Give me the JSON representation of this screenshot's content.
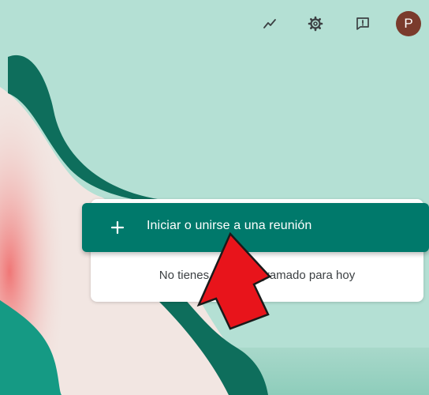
{
  "header": {
    "avatar_initial": "P",
    "icons": [
      "activity-icon",
      "gear-icon",
      "feedback-icon"
    ]
  },
  "main": {
    "action_button_label": "Iniciar o unirse a una reunión",
    "empty_message": "No tienes nada programado para hoy"
  },
  "colors": {
    "background": "#b0ded2",
    "accent": "#00796b",
    "avatar": "#7a3b2c",
    "arrow": "#e8141b"
  }
}
